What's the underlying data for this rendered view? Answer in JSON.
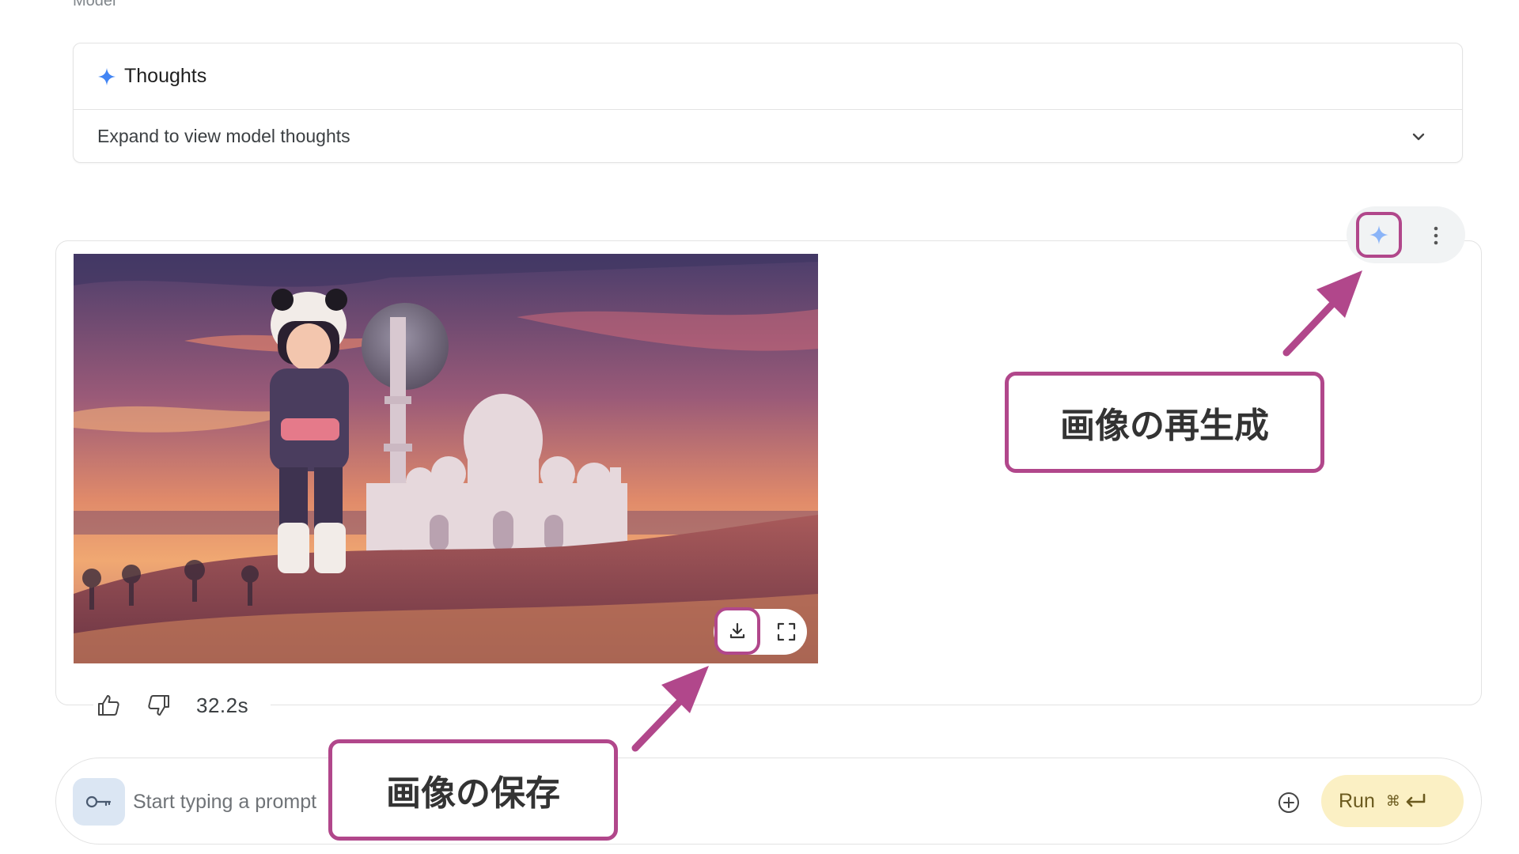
{
  "model_label": "Model",
  "thoughts": {
    "title": "Thoughts",
    "expand_text": "Expand to view model thoughts",
    "icon": "sparkle-icon",
    "chevron_icon": "chevron-down-icon"
  },
  "response": {
    "actions": {
      "regenerate_icon": "sparkle-icon",
      "more_icon": "more-vert-icon"
    },
    "image": {
      "alt": "Anime girl in panda hat standing in desert dunes at sunset in front of a white domed mosque with a large moon",
      "controls": {
        "download_icon": "download-icon",
        "fullscreen_icon": "fullscreen-icon"
      }
    },
    "feedback": {
      "thumbs_up_icon": "thumbs-up-icon",
      "thumbs_down_icon": "thumbs-down-icon",
      "elapsed": "32.2s"
    }
  },
  "prompt_bar": {
    "key_icon": "key-icon",
    "placeholder": "Start typing a prompt",
    "add_icon": "add-circle-icon",
    "run_label": "Run",
    "run_shortcut": "⌘"
  },
  "annotations": {
    "regenerate": "画像の再生成",
    "save": "画像の保存",
    "accent_color": "#b1478b"
  },
  "colors": {
    "spark_blue": "#4285f4",
    "run_bg": "#fbf0c4",
    "key_bg": "#dbe6f3"
  }
}
